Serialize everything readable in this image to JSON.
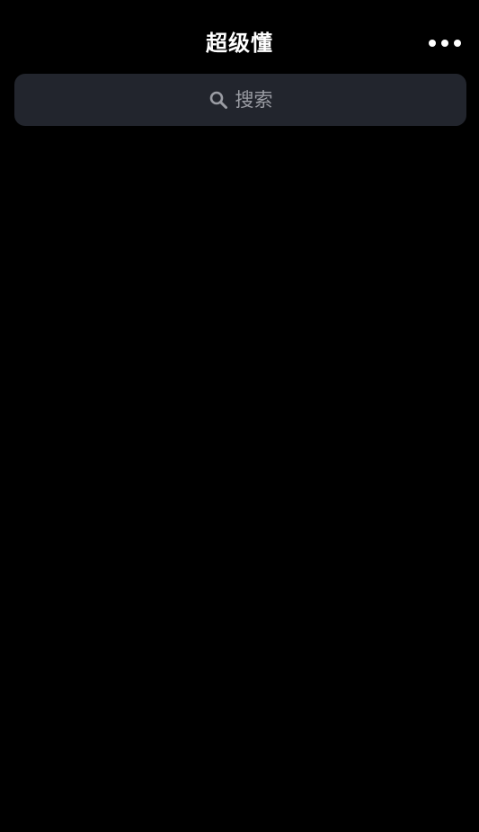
{
  "header": {
    "title": "超级懂",
    "more_icon": "more-horizontal-icon"
  },
  "search": {
    "placeholder": "搜索",
    "icon": "search-icon"
  },
  "colors": {
    "background": "#000000",
    "search_bar": "#22252d",
    "placeholder_text": "#9a9ca3",
    "title_text": "#ffffff"
  }
}
